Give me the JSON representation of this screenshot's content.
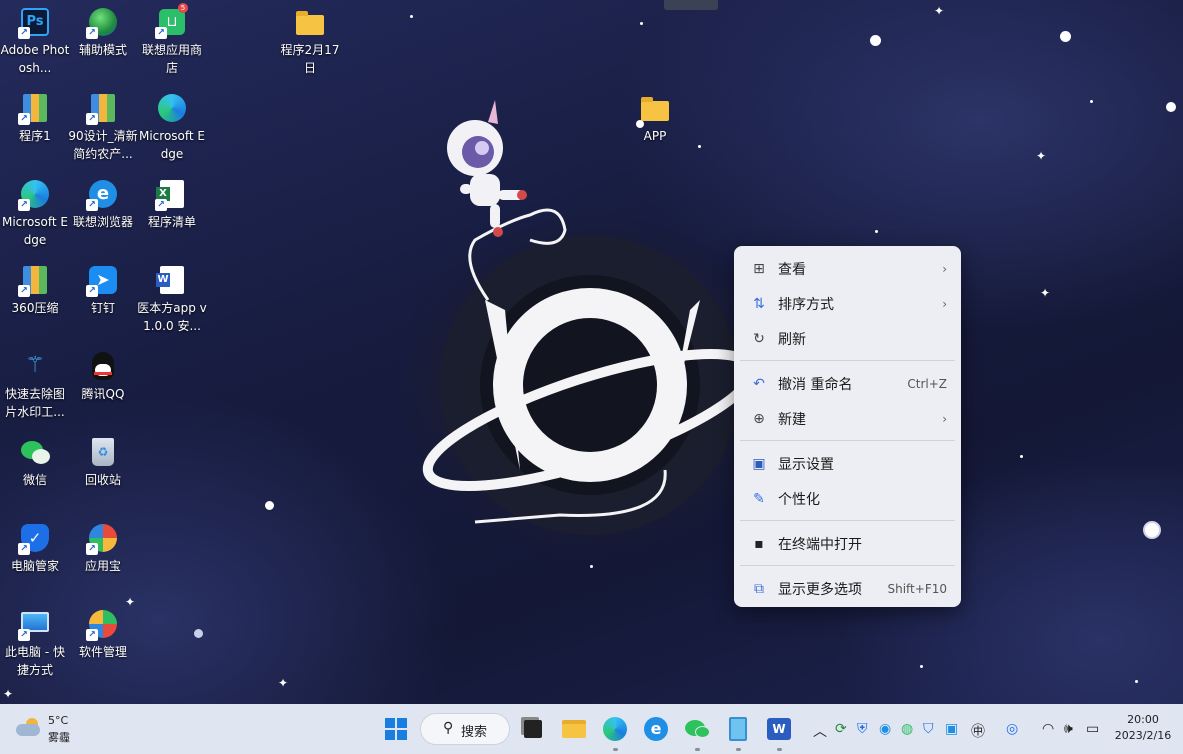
{
  "desktop": {
    "icons": [
      {
        "label": "Adobe Photosh...",
        "icon": "photoshop-icon"
      },
      {
        "label": "辅助模式",
        "icon": "globe-icon"
      },
      {
        "label": "联想应用商店",
        "icon": "lenovo-store-icon",
        "badge": "5"
      },
      {
        "label": "程序2月17日",
        "icon": "folder-icon"
      },
      {
        "label": "APP",
        "icon": "folder-icon"
      },
      {
        "label": "程序1",
        "icon": "archive-icon"
      },
      {
        "label": "90设计_清新简约农产...",
        "icon": "archive-icon"
      },
      {
        "label": "Microsoft Edge",
        "icon": "edge-icon"
      },
      {
        "label": "Microsoft Edge",
        "icon": "edge-icon"
      },
      {
        "label": "联想浏览器",
        "icon": "lenovo-browser-icon"
      },
      {
        "label": "程序清单",
        "icon": "excel-icon"
      },
      {
        "label": "360压缩",
        "icon": "archive-icon"
      },
      {
        "label": "钉钉",
        "icon": "dingtalk-icon"
      },
      {
        "label": "医本方app v1.0.0 安...",
        "icon": "word-icon"
      },
      {
        "label": "快速去除图片水印工...",
        "icon": "magic-wand-icon"
      },
      {
        "label": "腾讯QQ",
        "icon": "qq-icon"
      },
      {
        "label": "微信",
        "icon": "wechat-icon"
      },
      {
        "label": "回收站",
        "icon": "recycle-bin-icon"
      },
      {
        "label": "电脑管家",
        "icon": "pc-manager-icon"
      },
      {
        "label": "应用宝",
        "icon": "app-store-icon"
      },
      {
        "label": "此电脑 - 快捷方式",
        "icon": "this-pc-icon"
      },
      {
        "label": "软件管理",
        "icon": "software-manager-icon"
      }
    ]
  },
  "context_menu": {
    "items": [
      {
        "label": "查看",
        "icon": "grid-icon",
        "submenu": true,
        "shortcut": ""
      },
      {
        "label": "排序方式",
        "icon": "sort-icon",
        "submenu": true,
        "shortcut": ""
      },
      {
        "label": "刷新",
        "icon": "refresh-icon",
        "submenu": false,
        "shortcut": ""
      },
      {
        "label": "撤消 重命名",
        "icon": "undo-icon",
        "submenu": false,
        "shortcut": "Ctrl+Z"
      },
      {
        "label": "新建",
        "icon": "new-icon",
        "submenu": true,
        "shortcut": ""
      },
      {
        "label": "显示设置",
        "icon": "display-settings-icon",
        "submenu": false,
        "shortcut": ""
      },
      {
        "label": "个性化",
        "icon": "brush-icon",
        "submenu": false,
        "shortcut": ""
      },
      {
        "label": "在终端中打开",
        "icon": "terminal-icon",
        "submenu": false,
        "shortcut": ""
      },
      {
        "label": "显示更多选项",
        "icon": "more-options-icon",
        "submenu": false,
        "shortcut": "Shift+F10"
      }
    ]
  },
  "taskbar": {
    "weather": {
      "temp": "5°C",
      "condition": "雾霾"
    },
    "search_label": "搜索",
    "clock": {
      "time": "20:00",
      "date": "2023/2/16"
    }
  },
  "colors": {
    "menu_bg": "#eceef3",
    "taskbar_bg": "#dfe6f2",
    "desktop_bg": "#171c40",
    "folder": "#f6c343"
  }
}
